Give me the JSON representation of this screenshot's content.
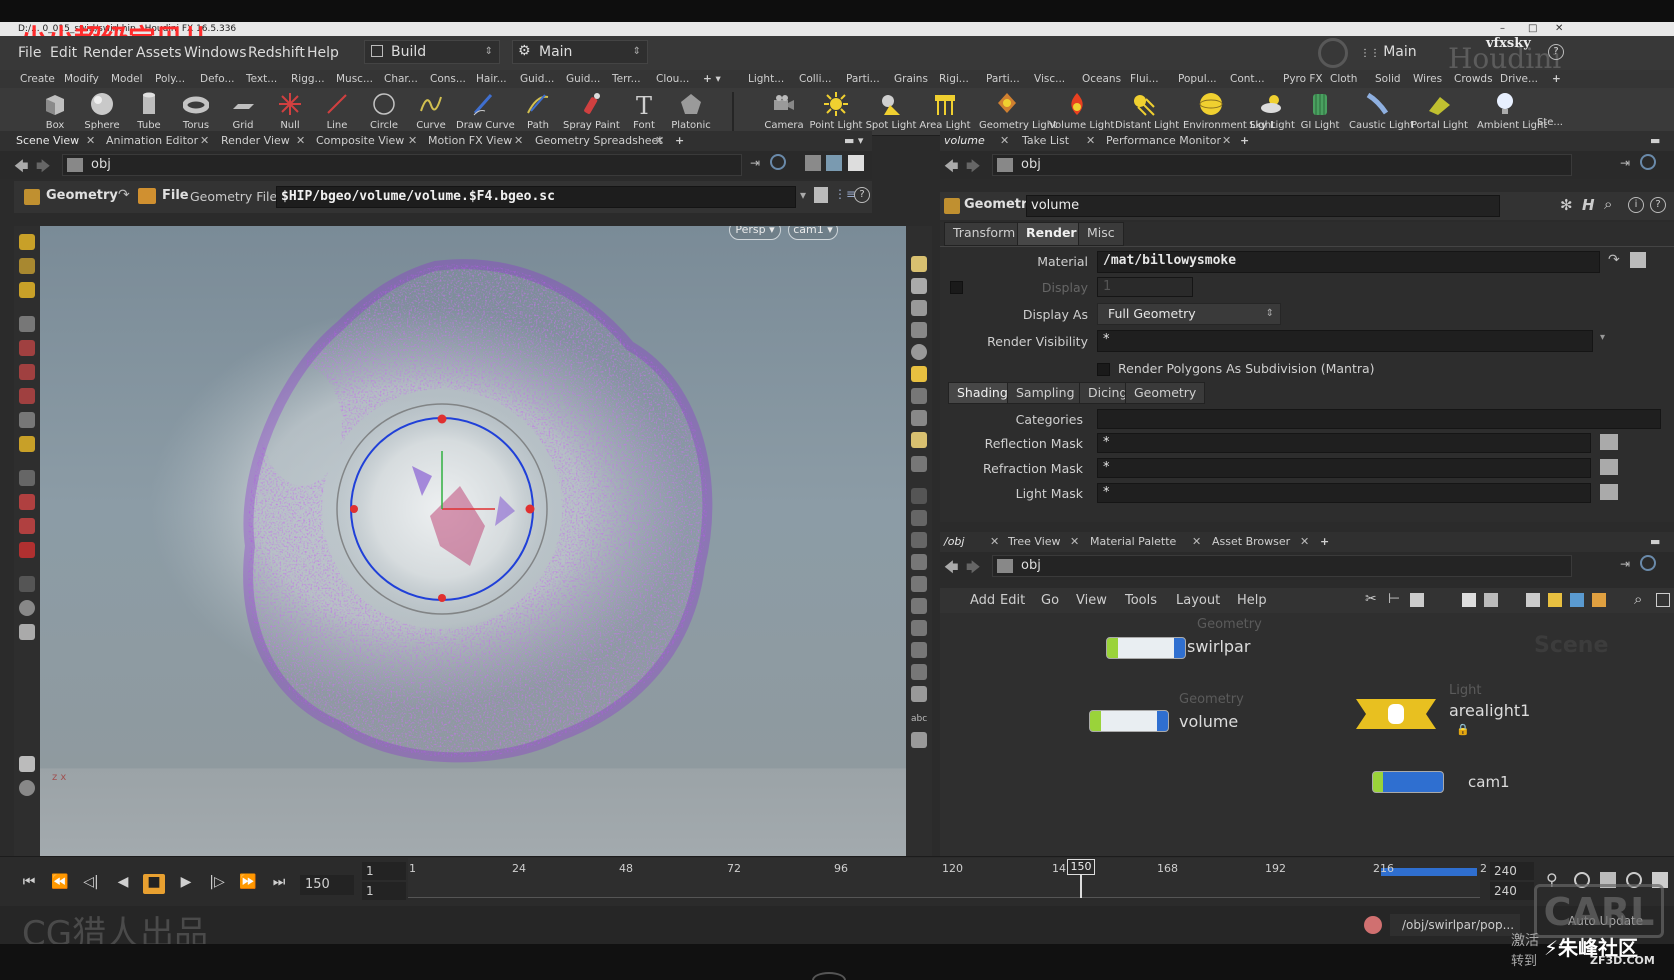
{
  "overlay": {
    "watermark_top": "小小超级宝贝儿",
    "watermark_bottom": "CG猎人出品",
    "watermark_br": "朱峰社区",
    "watermark_br_url": "ZF3D.COM",
    "watermark_br_small": "激活",
    "watermark_br_small2": "转到",
    "carl": "CARL",
    "houdini_brand": "Houdini",
    "vfxsky": "vfxsky"
  },
  "window": {
    "title": "D:/... 0_015_swirl/swirl.hip - Houdini FX 16.5.336"
  },
  "menubar": {
    "items": [
      "File",
      "Edit",
      "Render",
      "Assets",
      "Windows",
      "Redshift",
      "Help"
    ],
    "desktop": "Build",
    "context": "Main",
    "right_context": "Main"
  },
  "shelf_tabs_left": [
    "Create",
    "Modify",
    "Model",
    "Poly...",
    "Defo...",
    "Text...",
    "Rigg...",
    "Musc...",
    "Char...",
    "Cons...",
    "Hair...",
    "Guid...",
    "Guid...",
    "Terr...",
    "Clou..."
  ],
  "shelf_tabs_right": [
    "Light...",
    "Colli...",
    "Parti...",
    "Grains",
    "Rigi...",
    "Parti...",
    "Visc...",
    "Oceans",
    "Flui...",
    "Popul...",
    "Cont...",
    "Pyro FX",
    "Cloth",
    "Solid",
    "Wires",
    "Crowds",
    "Drive..."
  ],
  "shelf_tools_left": [
    "Box",
    "Sphere",
    "Tube",
    "Torus",
    "Grid",
    "Null",
    "Line",
    "Circle",
    "Curve",
    "Draw Curve",
    "Path",
    "Spray Paint",
    "Font",
    "Platonic"
  ],
  "shelf_tools_right": [
    "Camera",
    "Point Light",
    "Spot Light",
    "Area Light",
    "Geometry Light",
    "Volume Light",
    "Distant Light",
    "Environment Light",
    "Sky Light",
    "GI Light",
    "Caustic Light",
    "Portal Light",
    "Ambient Light",
    "Ste..."
  ],
  "left_pane": {
    "tabs": [
      "Scene View",
      "Animation Editor",
      "Render View",
      "Composite View",
      "Motion FX View",
      "Geometry Spreadsheet"
    ],
    "path": "obj",
    "op_type": "Geometry",
    "file_label": "File",
    "geo_file_label": "Geometry File",
    "geo_file_value": "$HIP/bgeo/volume/volume.$F4.bgeo.sc",
    "persp": "Persp",
    "cam": "cam1",
    "axis": "z x"
  },
  "param_pane": {
    "tabs": [
      "volume",
      "Take List",
      "Performance Monitor"
    ],
    "path": "obj",
    "op_type": "Geometry",
    "node_name": "volume",
    "folder_tabs": [
      "Transform",
      "Render",
      "Misc"
    ],
    "active_folder": "Render",
    "material_label": "Material",
    "material_value": "/mat/billowysmoke",
    "display_label": "Display",
    "display_value": "1",
    "display_as_label": "Display As",
    "display_as_value": "Full Geometry",
    "render_vis_label": "Render Visibility",
    "render_vis_value": "*",
    "render_polys_label": "Render Polygons As Subdivision (Mantra)",
    "sub_tabs": [
      "Shading",
      "Sampling",
      "Dicing",
      "Geometry"
    ],
    "categories_label": "Categories",
    "categories_value": "",
    "reflection_label": "Reflection Mask",
    "reflection_value": "*",
    "refraction_label": "Refraction Mask",
    "refraction_value": "*",
    "lightmask_label": "Light Mask",
    "lightmask_value": "*"
  },
  "network_pane": {
    "tabs": [
      "/obj",
      "Tree View",
      "Material Palette",
      "Asset Browser"
    ],
    "path": "obj",
    "menu": [
      "Add",
      "Edit",
      "Go",
      "View",
      "Tools",
      "Layout",
      "Help"
    ],
    "scene_label": "Scene",
    "nodes": [
      {
        "type": "Geometry",
        "name": "swirlpar"
      },
      {
        "type": "Geometry",
        "name": "volume"
      },
      {
        "type": "Light",
        "name": "arealight1"
      },
      {
        "type": "",
        "name": "cam1"
      }
    ]
  },
  "timeline": {
    "current_frame": "150",
    "start": "1",
    "start2": "1",
    "ticks": [
      "1",
      "24",
      "48",
      "72",
      "96",
      "120",
      "14",
      "168",
      "192",
      "216",
      "2"
    ],
    "cursor": "150",
    "end": "240",
    "end2": "240"
  },
  "status": {
    "path": "/obj/swirlpar/pop...",
    "auto_update": "Auto Update"
  },
  "colors": {
    "accent_blue": "#2f6fd0",
    "particles": "#8a2fd0",
    "node_yellow": "#e8c020",
    "node_green": "#9ad33a"
  }
}
